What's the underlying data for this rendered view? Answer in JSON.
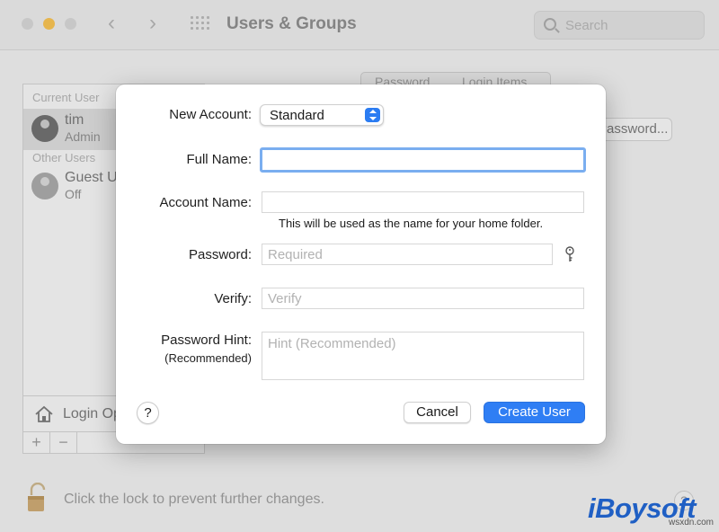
{
  "window": {
    "title": "Users & Groups",
    "search_placeholder": "Search",
    "lock_text": "Click the lock to prevent further changes.",
    "help": "?",
    "tabs": [
      "Password",
      "Login Items"
    ],
    "change_password_button": "Password..."
  },
  "sidebar": {
    "current_user_header": "Current User",
    "other_users_header": "Other Users",
    "users": [
      {
        "name": "tim",
        "role": "Admin"
      },
      {
        "name": "Guest User",
        "role": "Off"
      }
    ],
    "login_options": "Login Options",
    "add": "+",
    "remove": "−"
  },
  "dialog": {
    "new_account_label": "New Account:",
    "new_account_value": "Standard",
    "full_name_label": "Full Name:",
    "full_name_value": "",
    "account_name_label": "Account Name:",
    "account_name_value": "",
    "account_name_note": "This will be used as the name for your home folder.",
    "password_label": "Password:",
    "password_placeholder": "Required",
    "verify_label": "Verify:",
    "verify_placeholder": "Verify",
    "hint_label": "Password Hint:",
    "hint_sublabel": "(Recommended)",
    "hint_placeholder": "Hint (Recommended)",
    "help": "?",
    "cancel": "Cancel",
    "create": "Create User"
  },
  "watermark": {
    "brand": "iBoysoft",
    "site": "wsxdn.com"
  },
  "colors": {
    "accent": "#2f7ef4",
    "focus_ring": "#7aaef0",
    "minimize": "#f5bf4f"
  }
}
